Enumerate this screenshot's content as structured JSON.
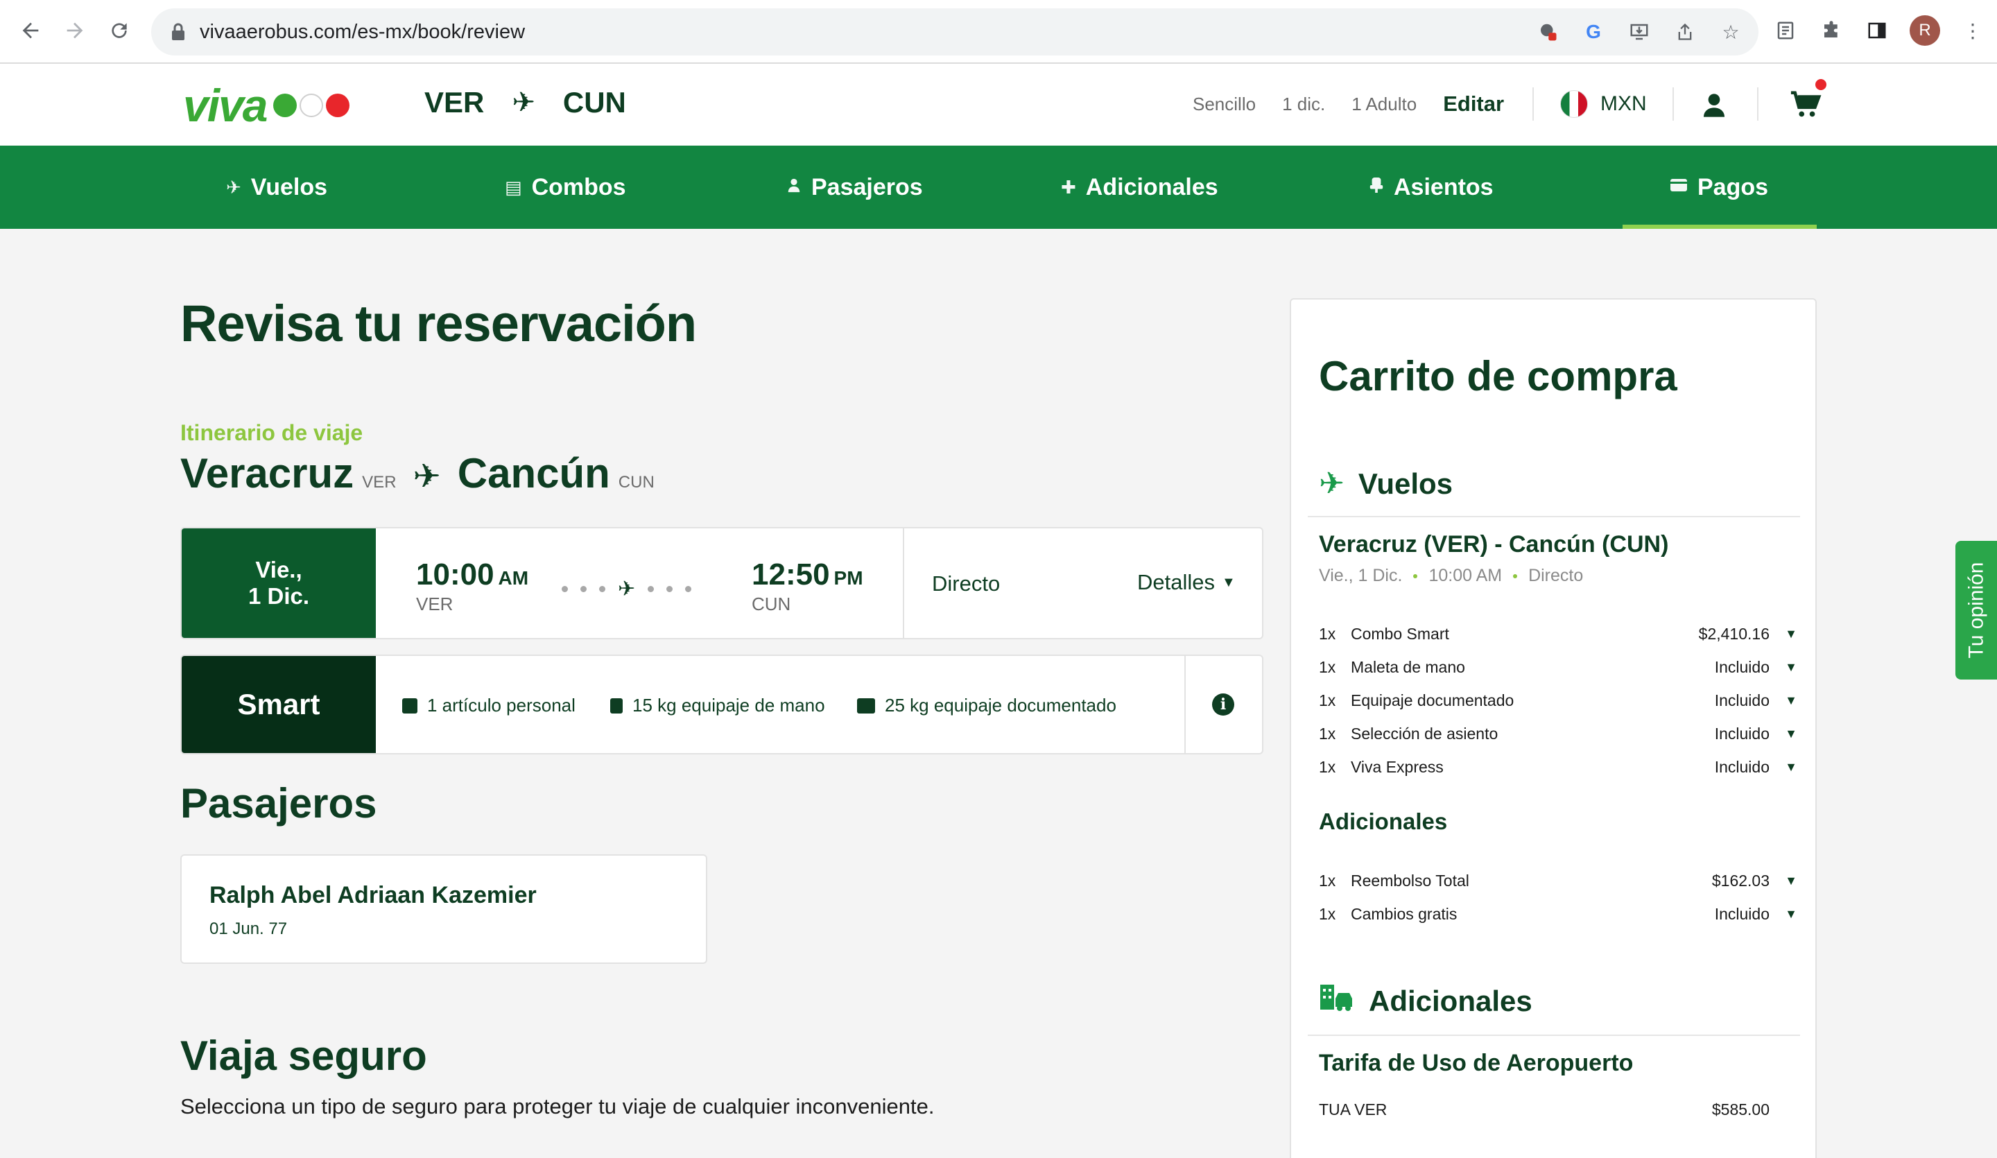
{
  "browser": {
    "url": "vivaaerobus.com/es-mx/book/review",
    "avatar_letter": "R"
  },
  "header": {
    "logo_text": "viva",
    "origin": "VER",
    "destination": "CUN",
    "trip_type": "Sencillo",
    "date": "1 dic.",
    "passengers": "1 Adulto",
    "edit_label": "Editar",
    "currency": "MXN"
  },
  "steps": [
    {
      "label": "Vuelos"
    },
    {
      "label": "Combos"
    },
    {
      "label": "Pasajeros"
    },
    {
      "label": "Adicionales"
    },
    {
      "label": "Asientos"
    },
    {
      "label": "Pagos"
    }
  ],
  "active_step": "Pagos",
  "main": {
    "title": "Revisa tu reservación",
    "itinerary_label": "Itinerario de viaje",
    "origin_city": "Veracruz",
    "origin_code": "VER",
    "destination_city": "Cancún",
    "destination_code": "CUN",
    "flight": {
      "day": "Vie.,",
      "date": "1 Dic.",
      "dep_time": "10:00",
      "dep_ampm": "AM",
      "dep_code": "VER",
      "arr_time": "12:50",
      "arr_ampm": "PM",
      "arr_code": "CUN",
      "type": "Directo",
      "details_label": "Detalles"
    },
    "fare": {
      "name": "Smart",
      "features": [
        "1 artículo personal",
        "15 kg equipaje de mano",
        "25 kg equipaje documentado"
      ]
    },
    "passengers_title": "Pasajeros",
    "passenger": {
      "name": "Ralph Abel Adriaan Kazemier",
      "dob": "01 Jun. 77"
    },
    "insurance_title": "Viaja seguro",
    "insurance_desc": "Selecciona un tipo de seguro para proteger tu viaje de cualquier inconveniente."
  },
  "cart": {
    "title": "Carrito de compra",
    "flights_head": "Vuelos",
    "route": "Veracruz (VER) - Cancún (CUN)",
    "sub_date": "Vie., 1 Dic.",
    "sub_time": "10:00 AM",
    "sub_type": "Directo",
    "flight_items": [
      {
        "qty": "1x",
        "name": "Combo Smart",
        "price": "$2,410.16"
      },
      {
        "qty": "1x",
        "name": "Maleta de mano",
        "price": "Incluido"
      },
      {
        "qty": "1x",
        "name": "Equipaje documentado",
        "price": "Incluido"
      },
      {
        "qty": "1x",
        "name": "Selección de asiento",
        "price": "Incluido"
      },
      {
        "qty": "1x",
        "name": "Viva Express",
        "price": "Incluido"
      }
    ],
    "addons_subhead": "Adicionales",
    "addon_items": [
      {
        "qty": "1x",
        "name": "Reembolso Total",
        "price": "$162.03"
      },
      {
        "qty": "1x",
        "name": "Cambios gratis",
        "price": "Incluido"
      }
    ],
    "extras_head": "Adicionales",
    "airport_fee_head": "Tarifa de Uso de Aeropuerto",
    "airport_fee": {
      "name": "TUA VER",
      "price": "$585.00"
    }
  },
  "feedback_label": "Tu opinión",
  "colors": {
    "brand_green": "#128641",
    "dark_green": "#0e3d22",
    "accent_lime": "#8dc63f"
  }
}
